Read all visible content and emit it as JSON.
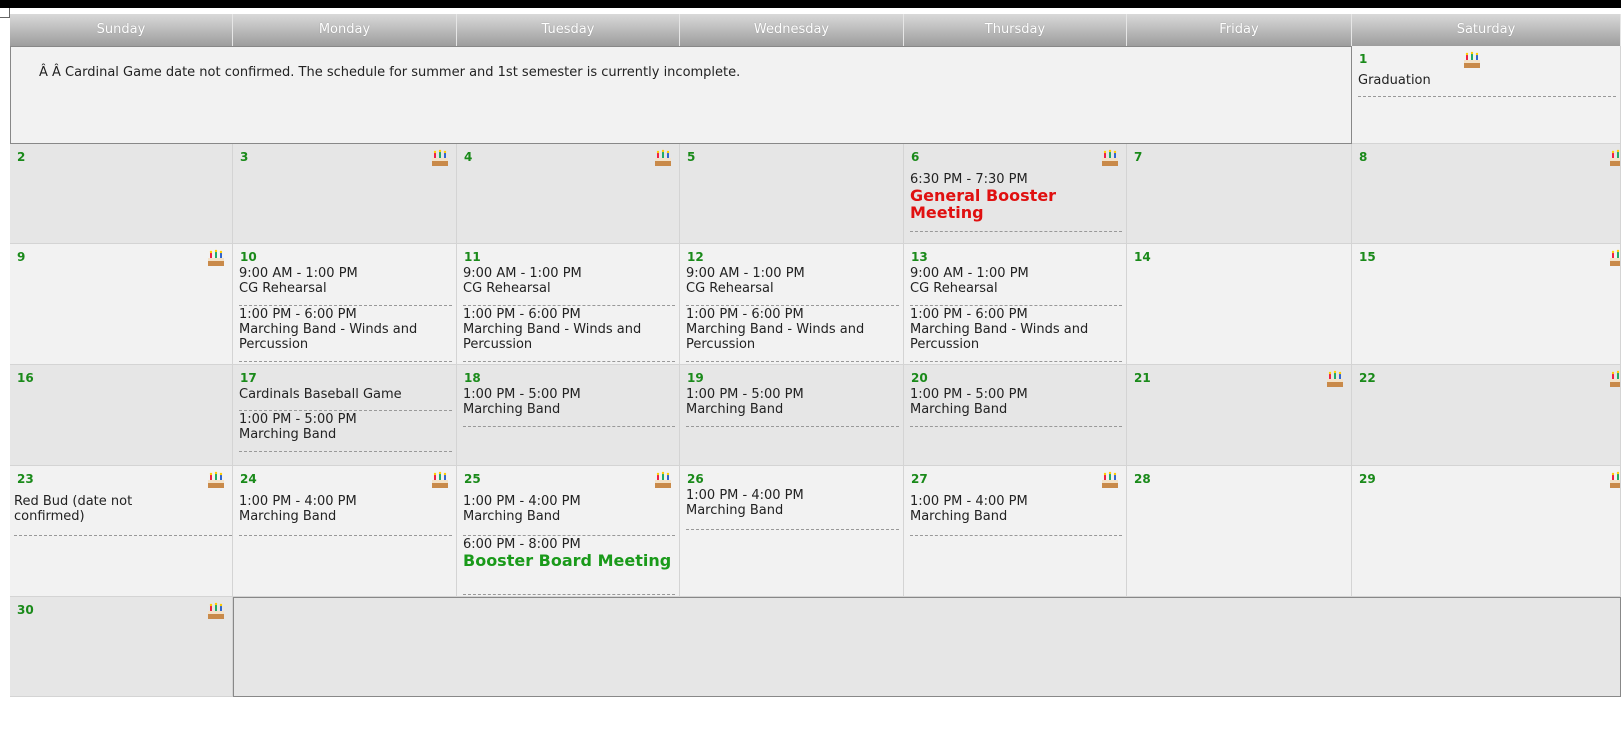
{
  "header": {
    "days": [
      "Sunday",
      "Monday",
      "Tuesday",
      "Wednesday",
      "Thursday",
      "Friday",
      "Saturday"
    ]
  },
  "note": "Â Â Cardinal Game date not confirmed. The schedule for summer and 1st semester is currently incomplete.",
  "week1": {
    "sat": {
      "day": "1",
      "events": [
        {
          "title": "Graduation"
        }
      ]
    }
  },
  "week2": {
    "sun": {
      "day": "2"
    },
    "mon": {
      "day": "3"
    },
    "tue": {
      "day": "4"
    },
    "wed": {
      "day": "5"
    },
    "thu": {
      "day": "6",
      "events": [
        {
          "time": "6:30 PM - 7:30 PM",
          "title": "General Booster Meeting"
        }
      ]
    },
    "fri": {
      "day": "7"
    },
    "sat": {
      "day": "8"
    }
  },
  "week3": {
    "sun": {
      "day": "9"
    },
    "mon": {
      "day": "10",
      "events": [
        {
          "time": "9:00 AM - 1:00 PM",
          "title": "CG Rehearsal"
        },
        {
          "time": "1:00 PM - 6:00 PM",
          "title": "Marching Band - Winds and Percussion"
        }
      ]
    },
    "tue": {
      "day": "11",
      "events": [
        {
          "time": "9:00 AM - 1:00 PM",
          "title": "CG Rehearsal"
        },
        {
          "time": "1:00 PM - 6:00 PM",
          "title": "Marching Band - Winds and Percussion"
        }
      ]
    },
    "wed": {
      "day": "12",
      "events": [
        {
          "time": "9:00 AM - 1:00 PM",
          "title": "CG Rehearsal"
        },
        {
          "time": "1:00 PM - 6:00 PM",
          "title": "Marching Band - Winds and Percussion"
        }
      ]
    },
    "thu": {
      "day": "13",
      "events": [
        {
          "time": "9:00 AM - 1:00 PM",
          "title": "CG Rehearsal"
        },
        {
          "time": "1:00 PM - 6:00 PM",
          "title": "Marching Band - Winds and Percussion"
        }
      ]
    },
    "fri": {
      "day": "14"
    },
    "sat": {
      "day": "15"
    }
  },
  "week4": {
    "sun": {
      "day": "16"
    },
    "mon": {
      "day": "17",
      "events": [
        {
          "title": "Cardinals Baseball Game"
        },
        {
          "time": "1:00 PM - 5:00 PM",
          "title": "Marching Band"
        }
      ]
    },
    "tue": {
      "day": "18",
      "events": [
        {
          "time": "1:00 PM - 5:00 PM",
          "title": "Marching Band"
        }
      ]
    },
    "wed": {
      "day": "19",
      "events": [
        {
          "time": "1:00 PM - 5:00 PM",
          "title": "Marching Band"
        }
      ]
    },
    "thu": {
      "day": "20",
      "events": [
        {
          "time": "1:00 PM - 5:00 PM",
          "title": "Marching Band"
        }
      ]
    },
    "fri": {
      "day": "21"
    },
    "sat": {
      "day": "22"
    }
  },
  "week5": {
    "sun": {
      "day": "23",
      "events": [
        {
          "title": "Red Bud (date not confirmed)"
        }
      ]
    },
    "mon": {
      "day": "24",
      "events": [
        {
          "time": "1:00 PM - 4:00 PM",
          "title": "Marching Band"
        }
      ]
    },
    "tue": {
      "day": "25",
      "events": [
        {
          "time": "1:00 PM - 4:00 PM",
          "title": "Marching Band"
        },
        {
          "time": "6:00 PM - 8:00 PM",
          "title": "Booster Board Meeting"
        }
      ]
    },
    "wed": {
      "day": "26",
      "events": [
        {
          "time": "1:00 PM - 4:00 PM",
          "title": "Marching Band"
        }
      ]
    },
    "thu": {
      "day": "27",
      "events": [
        {
          "time": "1:00 PM - 4:00 PM",
          "title": "Marching Band"
        }
      ]
    },
    "fri": {
      "day": "28"
    },
    "sat": {
      "day": "29"
    }
  },
  "week6": {
    "sun": {
      "day": "30"
    }
  },
  "icons": {
    "birthday": "birthday-cake-icon"
  },
  "colors": {
    "day_number": "#1a8a1a",
    "highlight_red": "#e01010",
    "highlight_green": "#1a9a1a"
  }
}
